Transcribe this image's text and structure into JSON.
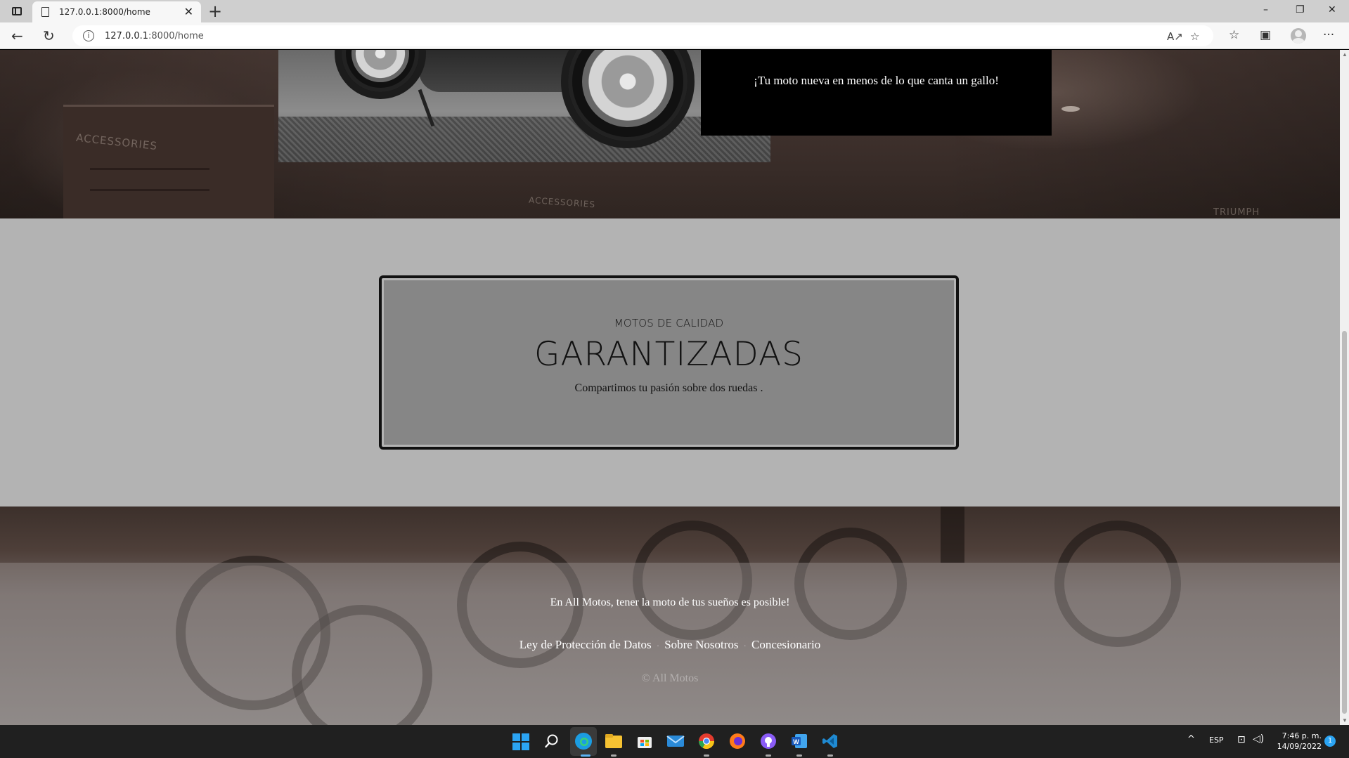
{
  "browser": {
    "tab_title": "127.0.0.1:8000/home",
    "tab_close": "✕",
    "new_tab": "+",
    "url_host": "127.0.0.1",
    "url_path": ":8000/home",
    "window_controls": [
      "–",
      "❐",
      "✕"
    ],
    "nav": {
      "back": "←",
      "reload": "↻"
    },
    "omnibox_icons": {
      "info": "i",
      "read_aloud": "A↗",
      "favorite_add": "☆"
    },
    "tools": {
      "favorites": "☆",
      "collections": "▣",
      "more": "···"
    }
  },
  "hero": {
    "promo_text": "¡Tu moto nueva en menos de lo que canta un gallo!",
    "sign_left": "ACCESSORIES",
    "sign_center": "ACCESSORIES",
    "sign_right": "TRIUMPH"
  },
  "quality": {
    "kicker": "MOTOS DE CALIDAD",
    "title": "GARANTIZADAS",
    "subtitle": "Compartimos tu pasión sobre dos ruedas ."
  },
  "footer": {
    "slogan": "En All Motos, tener la moto de tus sueños es posible!",
    "links": [
      "Ley de Protección de Datos",
      "Sobre Nosotros",
      "Concesionario"
    ],
    "separator": "·",
    "copyright": "© All Motos"
  },
  "taskbar": {
    "apps": [
      "search",
      "edge",
      "file-explorer",
      "store",
      "mail",
      "chrome",
      "firefox",
      "github-desktop",
      "word",
      "vscode"
    ],
    "tray_up": "^",
    "language": "ESP",
    "time": "7:46 p. m.",
    "date": "14/09/2022",
    "notifications": "1"
  },
  "colors": {
    "quality_bg": "#b3b3b3",
    "quality_card": "#868686",
    "promo_bg": "#000000",
    "taskbar": "#202020",
    "windows_blue": "#2ba4f3"
  }
}
